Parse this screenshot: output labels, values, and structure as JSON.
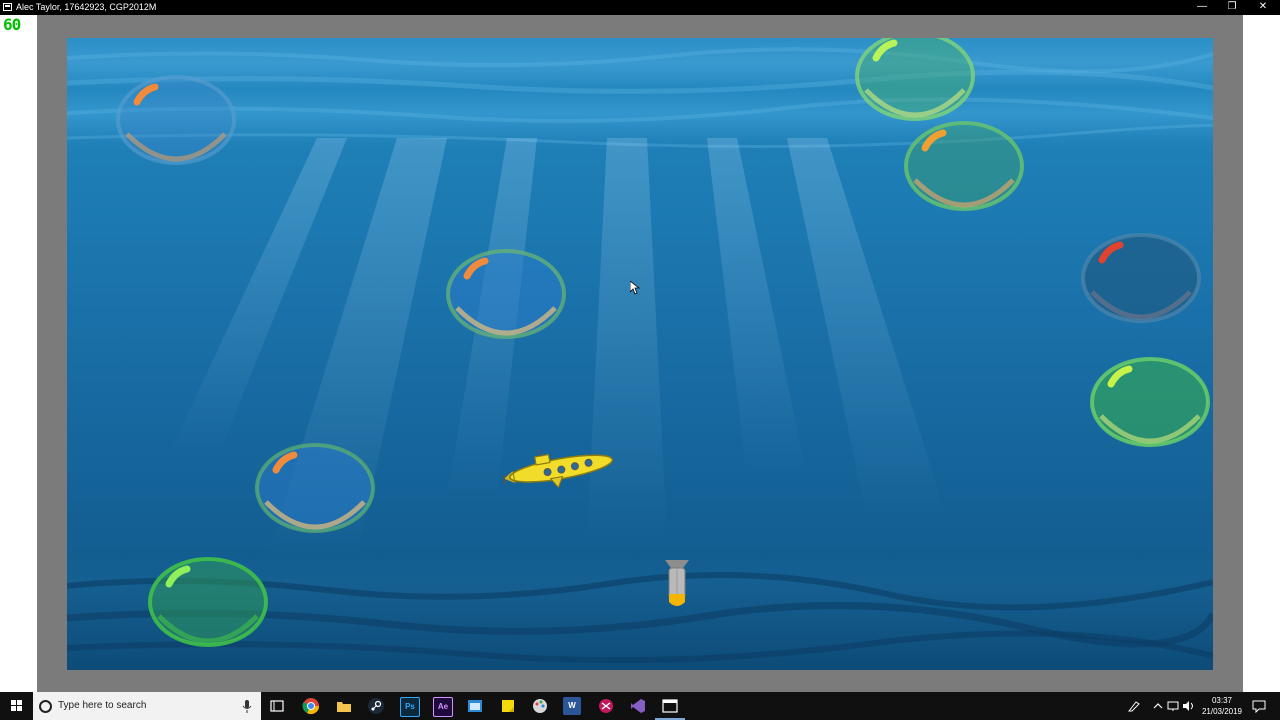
{
  "window": {
    "title": "Alec Taylor, 17642923, CGP2012M",
    "minimize_glyph": "—",
    "restore_glyph": "❐",
    "close_glyph": "✕"
  },
  "hud": {
    "fps": "60"
  },
  "game": {
    "bubble_colors": {
      "blue": "#3b86c8",
      "green": "#39b34a",
      "highlight_orange": "#f08a3c",
      "highlight_green": "#b9f35a",
      "highlight_red": "#e0432f"
    },
    "sprites": [
      "submarine",
      "bomb",
      "bubble"
    ]
  },
  "taskbar": {
    "search_placeholder": "Type here to search",
    "icons": [
      "windows-start-icon",
      "task-view-icon",
      "chrome-icon",
      "file-explorer-icon",
      "steam-icon",
      "photoshop-icon",
      "after-effects-icon",
      "app-window-icon",
      "sticky-notes-icon",
      "paint-icon",
      "word-icon",
      "snipping-icon",
      "visual-studio-icon",
      "game-window-icon"
    ],
    "photoshop_label": "Ps",
    "after_effects_label": "Ae",
    "word_label": "W",
    "clock": {
      "time": "03:37",
      "date": "21/03/2019"
    }
  }
}
